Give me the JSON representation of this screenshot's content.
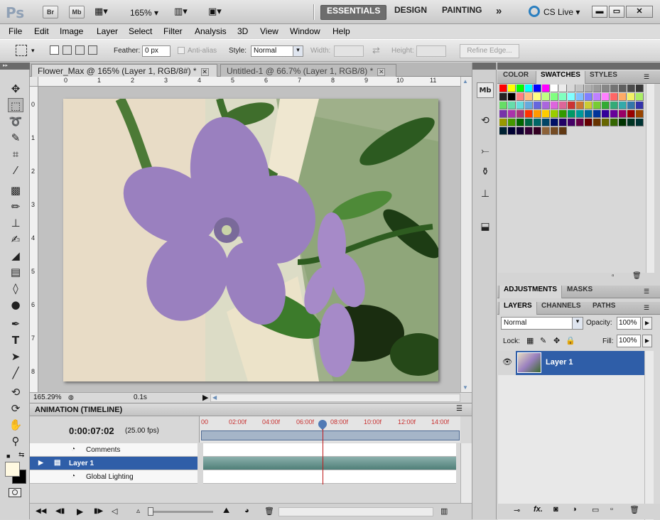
{
  "app": {
    "logo": "Ps",
    "bridge_btn": "Br",
    "minibridge_btn": "Mb",
    "zoom": "165%",
    "workspaces": [
      "ESSENTIALS",
      "DESIGN",
      "PAINTING"
    ],
    "more": "»",
    "cslive": "CS Live"
  },
  "menu": [
    "File",
    "Edit",
    "Image",
    "Layer",
    "Select",
    "Filter",
    "Analysis",
    "3D",
    "View",
    "Window",
    "Help"
  ],
  "options": {
    "feather_label": "Feather:",
    "feather_value": "0 px",
    "antialias_label": "Anti-alias",
    "style_label": "Style:",
    "style_value": "Normal",
    "width_label": "Width:",
    "height_label": "Height:",
    "refine_edge": "Refine Edge..."
  },
  "tabs": [
    {
      "label": "Flower_Max @ 165% (Layer 1, RGB/8#) *"
    },
    {
      "label": "Untitled-1 @ 66.7% (Layer 1, RGB/8) *"
    }
  ],
  "ruler_h": [
    "0",
    "1",
    "2",
    "3",
    "4",
    "5",
    "6",
    "7",
    "8",
    "9",
    "10",
    "11"
  ],
  "ruler_v": [
    "0",
    "1",
    "2",
    "3",
    "4",
    "5",
    "6",
    "7",
    "8"
  ],
  "status": {
    "zoom": "165.29%",
    "time": "0.1s"
  },
  "timeline": {
    "title": "ANIMATION (TIMELINE)",
    "current_time": "0:00:07:02",
    "fps": "(25.00 fps)",
    "ticks": [
      "00",
      "02:00f",
      "04:00f",
      "06:00f",
      "08:00f",
      "10:00f",
      "12:00f",
      "14:00f"
    ],
    "rows": [
      {
        "label": "Comments"
      },
      {
        "label": "Layer 1"
      },
      {
        "label": "Global Lighting"
      }
    ]
  },
  "panels": {
    "color_tabs": [
      "COLOR",
      "SWATCHES",
      "STYLES"
    ],
    "adj_tabs": [
      "ADJUSTMENTS",
      "MASKS"
    ],
    "layer_tabs": [
      "LAYERS",
      "CHANNELS",
      "PATHS"
    ],
    "blend_mode": "Normal",
    "opacity_label": "Opacity:",
    "opacity_value": "100%",
    "lock_label": "Lock:",
    "fill_label": "Fill:",
    "fill_value": "100%",
    "layer_name": "Layer 1"
  },
  "swatch_colors": [
    "#ff0000",
    "#ffff00",
    "#00ff00",
    "#00ffff",
    "#0000ff",
    "#ff00ff",
    "#ffffff",
    "#ebebeb",
    "#d7d7d7",
    "#c3c3c3",
    "#afafaf",
    "#9b9b9b",
    "#878787",
    "#737373",
    "#5f5f5f",
    "#4b4b4b",
    "#373737",
    "#232323",
    "#000000",
    "#ff8080",
    "#ffbf80",
    "#ffff80",
    "#bfff80",
    "#80ff80",
    "#80ffbf",
    "#80ffff",
    "#80bfff",
    "#8080ff",
    "#bf80ff",
    "#ff80ff",
    "#ff6666",
    "#ffaa66",
    "#f2f266",
    "#aaee66",
    "#66dd66",
    "#66ddaa",
    "#66dddd",
    "#66aadd",
    "#6666dd",
    "#aa66dd",
    "#dd66dd",
    "#dd6699",
    "#cc3333",
    "#cc7733",
    "#cccc33",
    "#77cc33",
    "#33aa33",
    "#33aa77",
    "#33aaaa",
    "#3377aa",
    "#3333aa",
    "#7733aa",
    "#aa33aa",
    "#aa3377",
    "#ff3300",
    "#ff9900",
    "#ffcc00",
    "#99cc00",
    "#339900",
    "#009966",
    "#009999",
    "#006699",
    "#003399",
    "#330099",
    "#660099",
    "#990066",
    "#990000",
    "#994400",
    "#999900",
    "#449900",
    "#006600",
    "#006644",
    "#006666",
    "#004466",
    "#001166",
    "#220066",
    "#440066",
    "#660044",
    "#660000",
    "#663300",
    "#666600",
    "#336600",
    "#003300",
    "#003322",
    "#003333",
    "#002233",
    "#000033",
    "#110033",
    "#330033",
    "#330022",
    "#8c6239",
    "#754c24",
    "#603813"
  ]
}
